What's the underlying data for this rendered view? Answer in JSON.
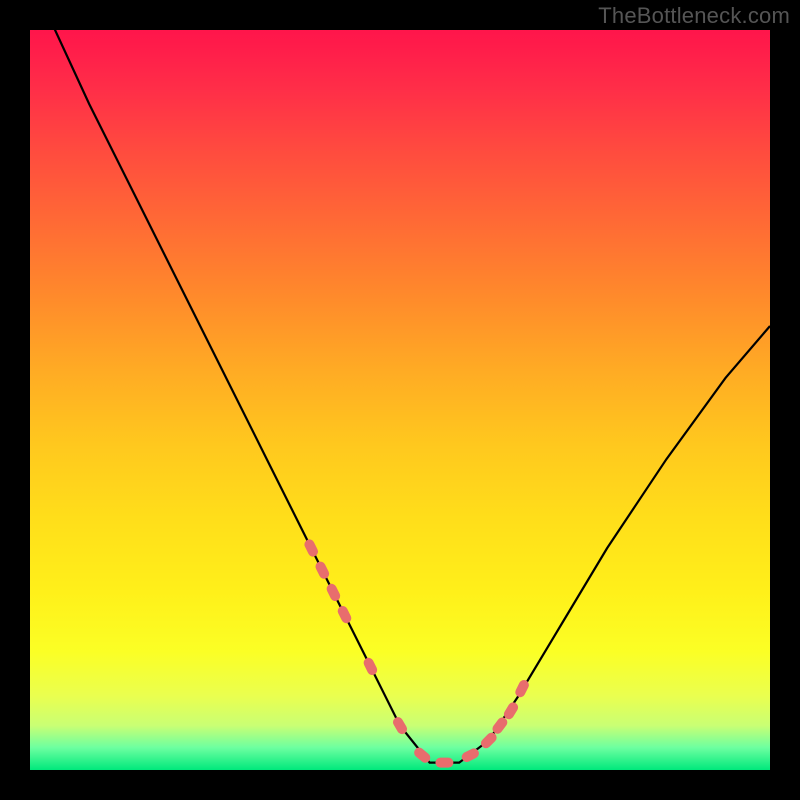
{
  "watermark": "TheBottleneck.com",
  "colors": {
    "background": "#000000",
    "gradient_top": "#ff154b",
    "gradient_mid": "#ffde1a",
    "gradient_bottom": "#00e97c",
    "curve": "#000000",
    "markers": "#e86d6d"
  },
  "chart_data": {
    "type": "line",
    "title": "",
    "xlabel": "",
    "ylabel": "",
    "xlim": [
      0,
      100
    ],
    "ylim": [
      0,
      100
    ],
    "notes": "V-shaped bottleneck curve with minimum near x≈55; y=0 indicates optimal (green), y=100 highest bottleneck (red).",
    "series": [
      {
        "name": "bottleneck_curve",
        "x": [
          2,
          8,
          14,
          20,
          26,
          32,
          38,
          42,
          46,
          50,
          54,
          58,
          62,
          66,
          72,
          78,
          86,
          94,
          100
        ],
        "y": [
          103,
          90,
          78,
          66,
          54,
          42,
          30,
          22,
          14,
          6,
          1,
          1,
          4,
          10,
          20,
          30,
          42,
          53,
          60
        ]
      }
    ],
    "markers": {
      "name": "highlighted_points",
      "x": [
        38,
        39.5,
        41,
        42.5,
        46,
        50,
        53,
        56,
        59.5,
        62,
        63.5,
        65,
        66.5
      ],
      "y": [
        30,
        27,
        24,
        21,
        14,
        6,
        2,
        1,
        2,
        4,
        6,
        8,
        11
      ]
    }
  }
}
